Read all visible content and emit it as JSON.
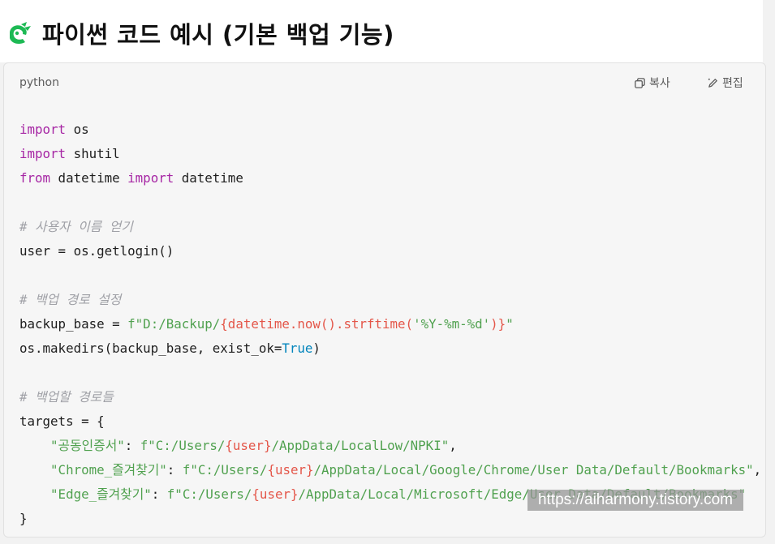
{
  "page": {
    "title": "파이썬 코드 예시 (기본 백업 기능)",
    "logo_icon": "green-dragon-logo-icon",
    "accent_color": "#1db954"
  },
  "code_block": {
    "language": "python",
    "copy_label": "복사",
    "edit_label": "편집",
    "copy_icon": "copy-icon",
    "edit_icon": "pencil-icon",
    "lines": {
      "l1_kw": "import",
      "l1_rest": " os",
      "l2_kw": "import",
      "l2_rest": " shutil",
      "l3_kw1": "from",
      "l3_mid": " datetime ",
      "l3_kw2": "import",
      "l3_rest": " datetime",
      "c1": "# 사용자 이름 얻기",
      "l5": "user = os.getlogin()",
      "c2": "# 백업 경로 설정",
      "l7_pre": "backup_base = ",
      "l7_str1": "f\"D:/Backup/",
      "l7_interp1": "{datetime.now().strftime(",
      "l7_str2": "'%Y-%m-%d'",
      "l7_interp2": ")}",
      "l7_str3": "\"",
      "l8_pre": "os.makedirs(backup_base, exist_ok=",
      "l8_true": "True",
      "l8_post": ")",
      "c3": "# 백업할 경로들",
      "l10": "targets = {",
      "t1_key": "\"공동인증서\"",
      "t1_sep": ": ",
      "t1_str1": "f\"C:/Users/",
      "t1_interp": "{user}",
      "t1_str2": "/AppData/LocalLow/NPKI\"",
      "t1_end": ",",
      "t2_key": "\"Chrome_즐겨찾기\"",
      "t2_sep": ": ",
      "t2_str1": "f\"C:/Users/",
      "t2_interp": "{user}",
      "t2_str2": "/AppData/Local/Google/Chrome/User Data/Default/Bookmarks\"",
      "t2_end": ",",
      "t3_key": "\"Edge_즐겨찾기\"",
      "t3_sep": ": ",
      "t3_str1": "f\"C:/Users/",
      "t3_interp": "{user}",
      "t3_str2": "/AppData/Local/Microsoft/Edge/User Data/Default/Bookmarks\"",
      "close": "}"
    }
  },
  "watermark": "https://aiharmony.tistory.com",
  "colors": {
    "keyword": "#a626a4",
    "string": "#50a14f",
    "interpolation": "#e45649",
    "builtin": "#0184bc",
    "comment": "#a0a1a7"
  }
}
